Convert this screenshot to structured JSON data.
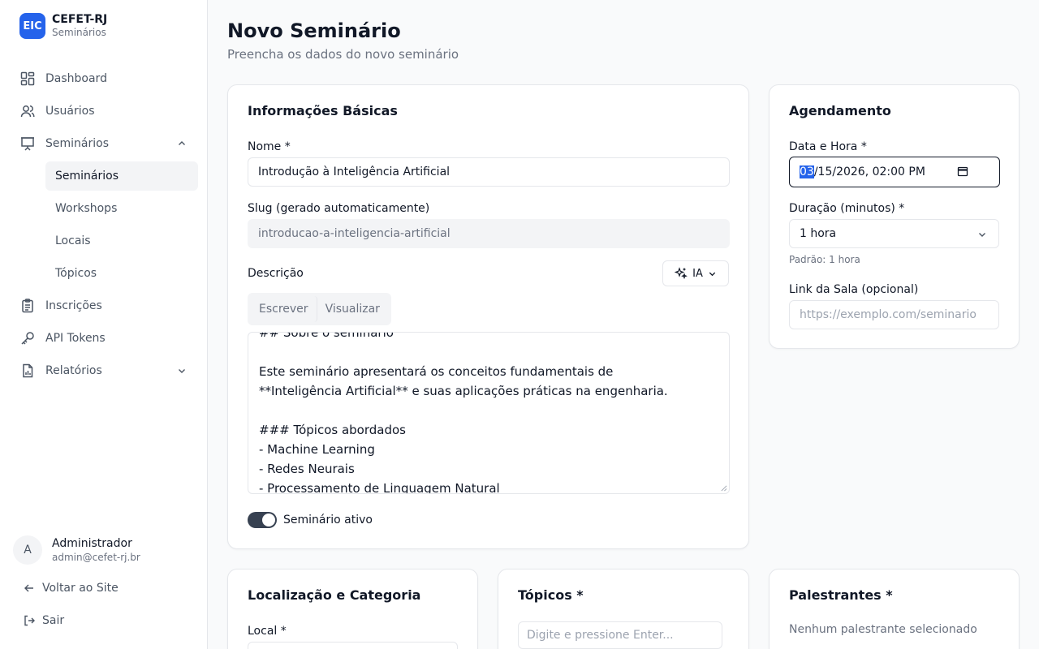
{
  "brand": {
    "logo": "EIC",
    "name": "CEFET-RJ",
    "subtitle": "Seminários"
  },
  "nav": {
    "items": [
      {
        "label": "Dashboard",
        "icon": "dashboard-icon"
      },
      {
        "label": "Usuários",
        "icon": "users-icon"
      },
      {
        "label": "Seminários",
        "icon": "presentation-icon",
        "expanded": true,
        "children": [
          {
            "label": "Seminários",
            "active": true
          },
          {
            "label": "Workshops"
          },
          {
            "label": "Locais"
          },
          {
            "label": "Tópicos"
          }
        ]
      },
      {
        "label": "Inscrições",
        "icon": "clipboard-icon"
      },
      {
        "label": "API Tokens",
        "icon": "key-icon"
      },
      {
        "label": "Relatórios",
        "icon": "report-icon",
        "expanded": false
      }
    ]
  },
  "user": {
    "initial": "A",
    "name": "Administrador",
    "email": "admin@cefet-rj.br"
  },
  "footer": {
    "back_label": "Voltar ao Site",
    "logout_label": "Sair"
  },
  "page": {
    "title": "Novo Seminário",
    "subtitle": "Preencha os dados do novo seminário"
  },
  "basic_info": {
    "title": "Informações Básicas",
    "name_label": "Nome *",
    "name_value": "Introdução à Inteligência Artificial",
    "slug_label": "Slug (gerado automaticamente)",
    "slug_value": "introducao-a-inteligencia-artificial",
    "description_label": "Descrição",
    "ia_label": "IA",
    "tabs": [
      "Escrever",
      "Visualizar"
    ],
    "description_lines": [
      "## Sobre o seminário",
      "",
      "Este seminário apresentará os conceitos fundamentais de",
      "**Inteligência Artificial** e suas aplicações práticas na engenharia.",
      "",
      "### Tópicos abordados",
      "- Machine Learning",
      "- Redes Neurais",
      "- Processamento de Linguagem Natural"
    ],
    "active_label": "Seminário ativo",
    "active": true
  },
  "scheduling": {
    "title": "Agendamento",
    "datetime_label": "Data e Hora *",
    "datetime_month": "03",
    "datetime_rest": "/15/2026, 02:00 PM",
    "duration_label": "Duração (minutos) *",
    "duration_value": "1 hora",
    "duration_hint": "Padrão: 1 hora",
    "link_label": "Link da Sala (opcional)",
    "link_placeholder": "https://exemplo.com/seminario"
  },
  "location": {
    "title": "Localização e Categoria",
    "local_label": "Local *"
  },
  "topics": {
    "title": "Tópicos *",
    "placeholder": "Digite e pressione Enter..."
  },
  "speakers": {
    "title": "Palestrantes *",
    "empty_text": "Nenhum palestrante selecionado"
  }
}
